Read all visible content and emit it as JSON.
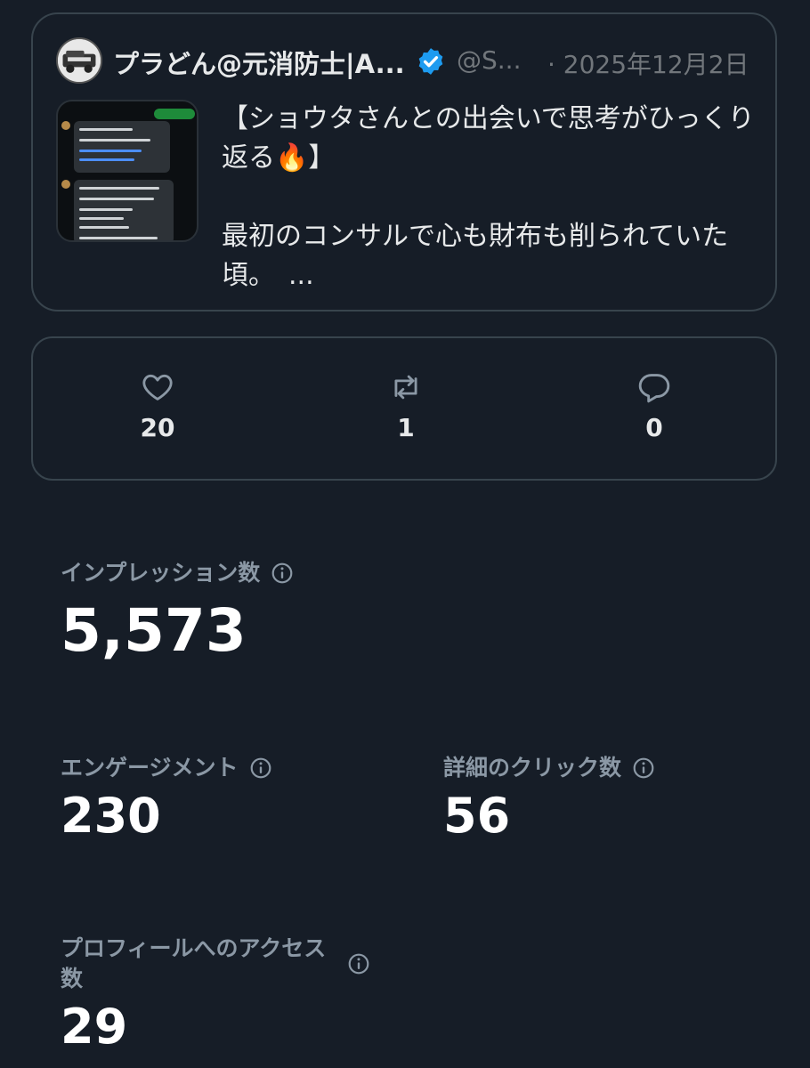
{
  "tweet": {
    "author_name": "プラどん@元消防士|A...",
    "handle": "@S...",
    "date": "· 2025年12月2日",
    "text": "【ショウタさんとの出会いで思考がひっくり返る🔥】\n\n最初のコンサルで心も財布も削られていた頃。　...",
    "thumbnail_alt": "chat-screenshot"
  },
  "actions": {
    "likes": "20",
    "reposts": "1",
    "replies": "0"
  },
  "metrics": {
    "impressions_label": "インプレッション数",
    "impressions_value": "5,573",
    "engagement_label": "エンゲージメント",
    "engagement_value": "230",
    "detail_clicks_label": "詳細のクリック数",
    "detail_clicks_value": "56",
    "profile_visits_label": "プロフィールへのアクセス数",
    "profile_visits_value": "29"
  },
  "colors": {
    "background": "#161d27",
    "border": "#38444d",
    "secondary_text": "#71767b",
    "verified_blue": "#1d9bf0"
  }
}
